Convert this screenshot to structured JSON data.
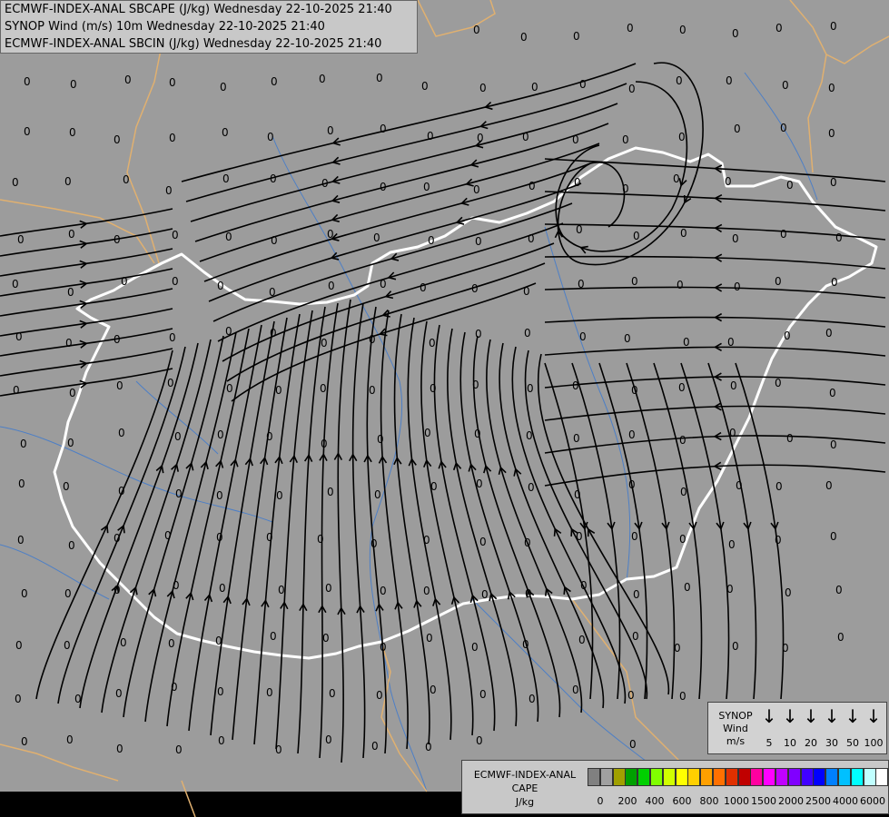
{
  "header": {
    "line1": "ECMWF-INDEX-ANAL SBCAPE (J/kg) Wednesday 22-10-2025 21:40",
    "line2": "SYNOP Wind (m/s) 10m Wednesday 22-10-2025 21:40",
    "line3": "ECMWF-INDEX-ANAL SBCIN (J/kg) Wednesday 22-10-2025 21:40"
  },
  "map": {
    "station_value": "0",
    "colors": {
      "land": "#9c9c9c",
      "country_border": "#e0b070",
      "region_border": "#ffffff",
      "river": "#4d7fc6",
      "streamline": "#000000"
    }
  },
  "synop_legend": {
    "title": [
      "SYNOP",
      "Wind",
      "m/s"
    ],
    "arrow_glyph": "↓",
    "speeds": [
      "5",
      "10",
      "20",
      "30",
      "50",
      "100"
    ]
  },
  "cape_legend": {
    "title": [
      "ECMWF-INDEX-ANAL",
      "CAPE",
      "J/kg"
    ],
    "colors": [
      "#808080",
      "#a0a0a0",
      "#a0a000",
      "#00a000",
      "#00d000",
      "#80ff00",
      "#d0ff00",
      "#ffff00",
      "#ffd000",
      "#ffa000",
      "#ff7000",
      "#e03000",
      "#c00000",
      "#ff00a0",
      "#ff00ff",
      "#c000ff",
      "#8000ff",
      "#4000ff",
      "#0000ff",
      "#0080ff",
      "#00c0ff",
      "#00ffff",
      "#c0ffff",
      "#ffffff"
    ],
    "ticks": [
      "0",
      "200",
      "400",
      "600",
      "800",
      "1000",
      "1500",
      "2000",
      "2500",
      "4000",
      "6000"
    ]
  }
}
